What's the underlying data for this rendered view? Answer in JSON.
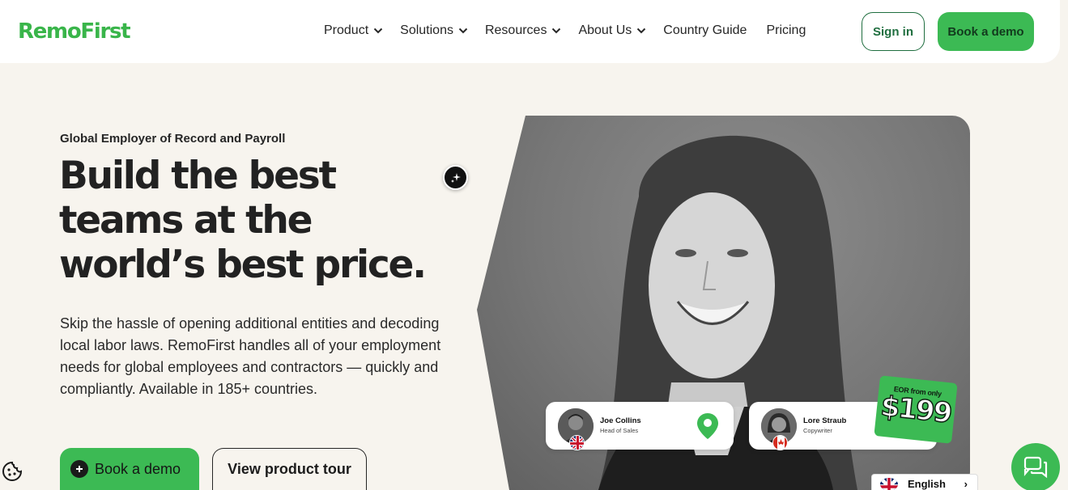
{
  "brand": {
    "logo_text": "RemoFirst",
    "accent": "#3cba54",
    "dark_green": "#1f6e3f"
  },
  "nav": {
    "items": [
      {
        "label": "Product",
        "has_dropdown": true
      },
      {
        "label": "Solutions",
        "has_dropdown": true
      },
      {
        "label": "Resources",
        "has_dropdown": true
      },
      {
        "label": "About Us",
        "has_dropdown": true
      },
      {
        "label": "Country Guide",
        "has_dropdown": false
      },
      {
        "label": "Pricing",
        "has_dropdown": false
      }
    ],
    "sign_in": "Sign in",
    "book_demo": "Book a demo"
  },
  "hero": {
    "eyebrow": "Global Employer of Record and Payroll",
    "headline": "Build the best teams at the world’s best price.",
    "body": "Skip the hassle of opening additional entities and decoding local labor laws. RemoFirst handles all of your employment needs for global employees and contractors — quickly and compliantly. Available in 185+ countries.",
    "primary_cta": "Book a demo",
    "secondary_cta": "View product tour"
  },
  "cards": [
    {
      "name": "Joe Collins",
      "role": "Head of Sales",
      "flag": "uk-flag-icon",
      "icon": "location-pin-icon"
    },
    {
      "name": "Lore Straub",
      "role": "Copywriter",
      "flag": "canada-flag-icon"
    }
  ],
  "price_tag": {
    "label": "EOR from only",
    "price": "$199"
  },
  "language": {
    "label": "English"
  },
  "icons": [
    "sparkle-chat-icon",
    "cookie-icon",
    "chat-icon",
    "chevron-down-icon",
    "plus-icon"
  ]
}
